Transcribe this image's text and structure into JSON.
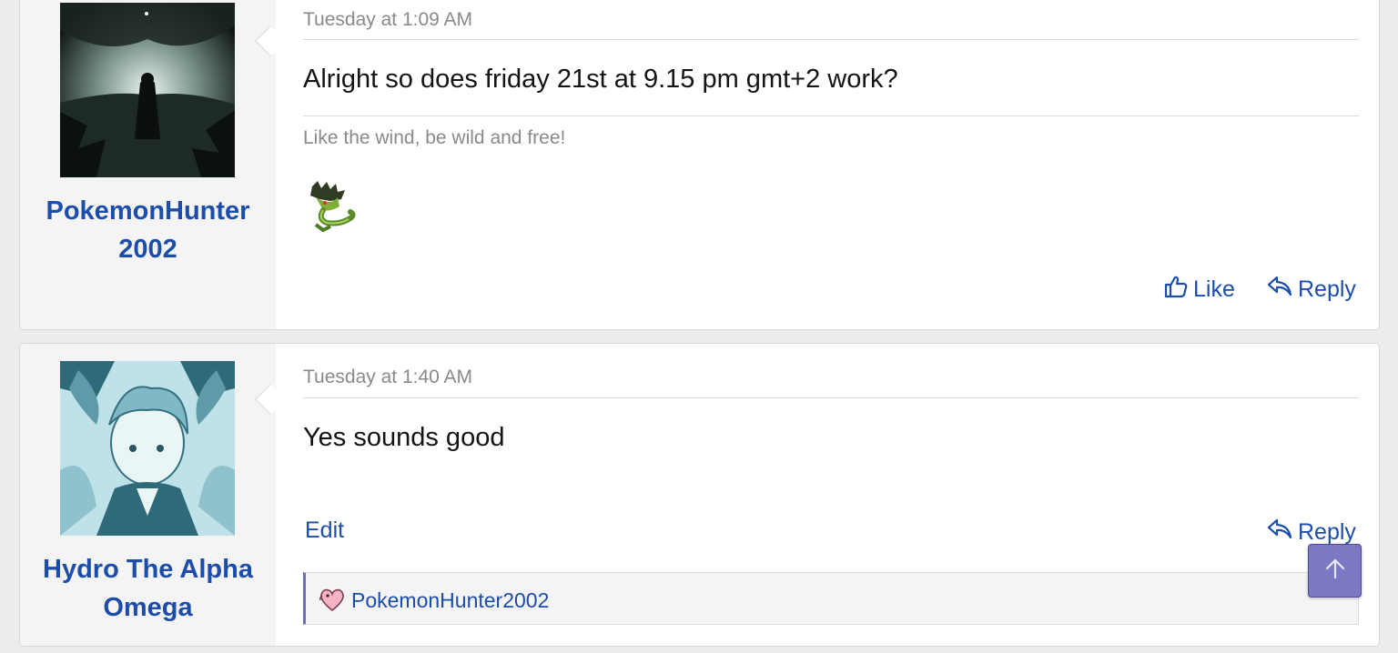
{
  "posts": [
    {
      "username_line1": "PokemonHunter",
      "username_line2": "2002",
      "date": "Tuesday at 1:09 AM",
      "message": "Alright so does friday 21st at 9.15 pm gmt+2 work?",
      "signature": "Like the wind, be wild and free!",
      "like_label": "Like",
      "reply_label": "Reply"
    },
    {
      "username_line1": "Hydro The Alpha",
      "username_line2": "Omega",
      "date": "Tuesday at 1:40 AM",
      "message": "Yes sounds good",
      "edit_label": "Edit",
      "reply_label": "Reply",
      "reaction_user": "PokemonHunter2002"
    }
  ],
  "colors": {
    "link": "#1c4dab",
    "scroll_button": "#7b79c4"
  },
  "icons": [
    "thumbs-up-icon",
    "reply-icon",
    "heart-reaction-icon",
    "arrow-up-icon"
  ]
}
